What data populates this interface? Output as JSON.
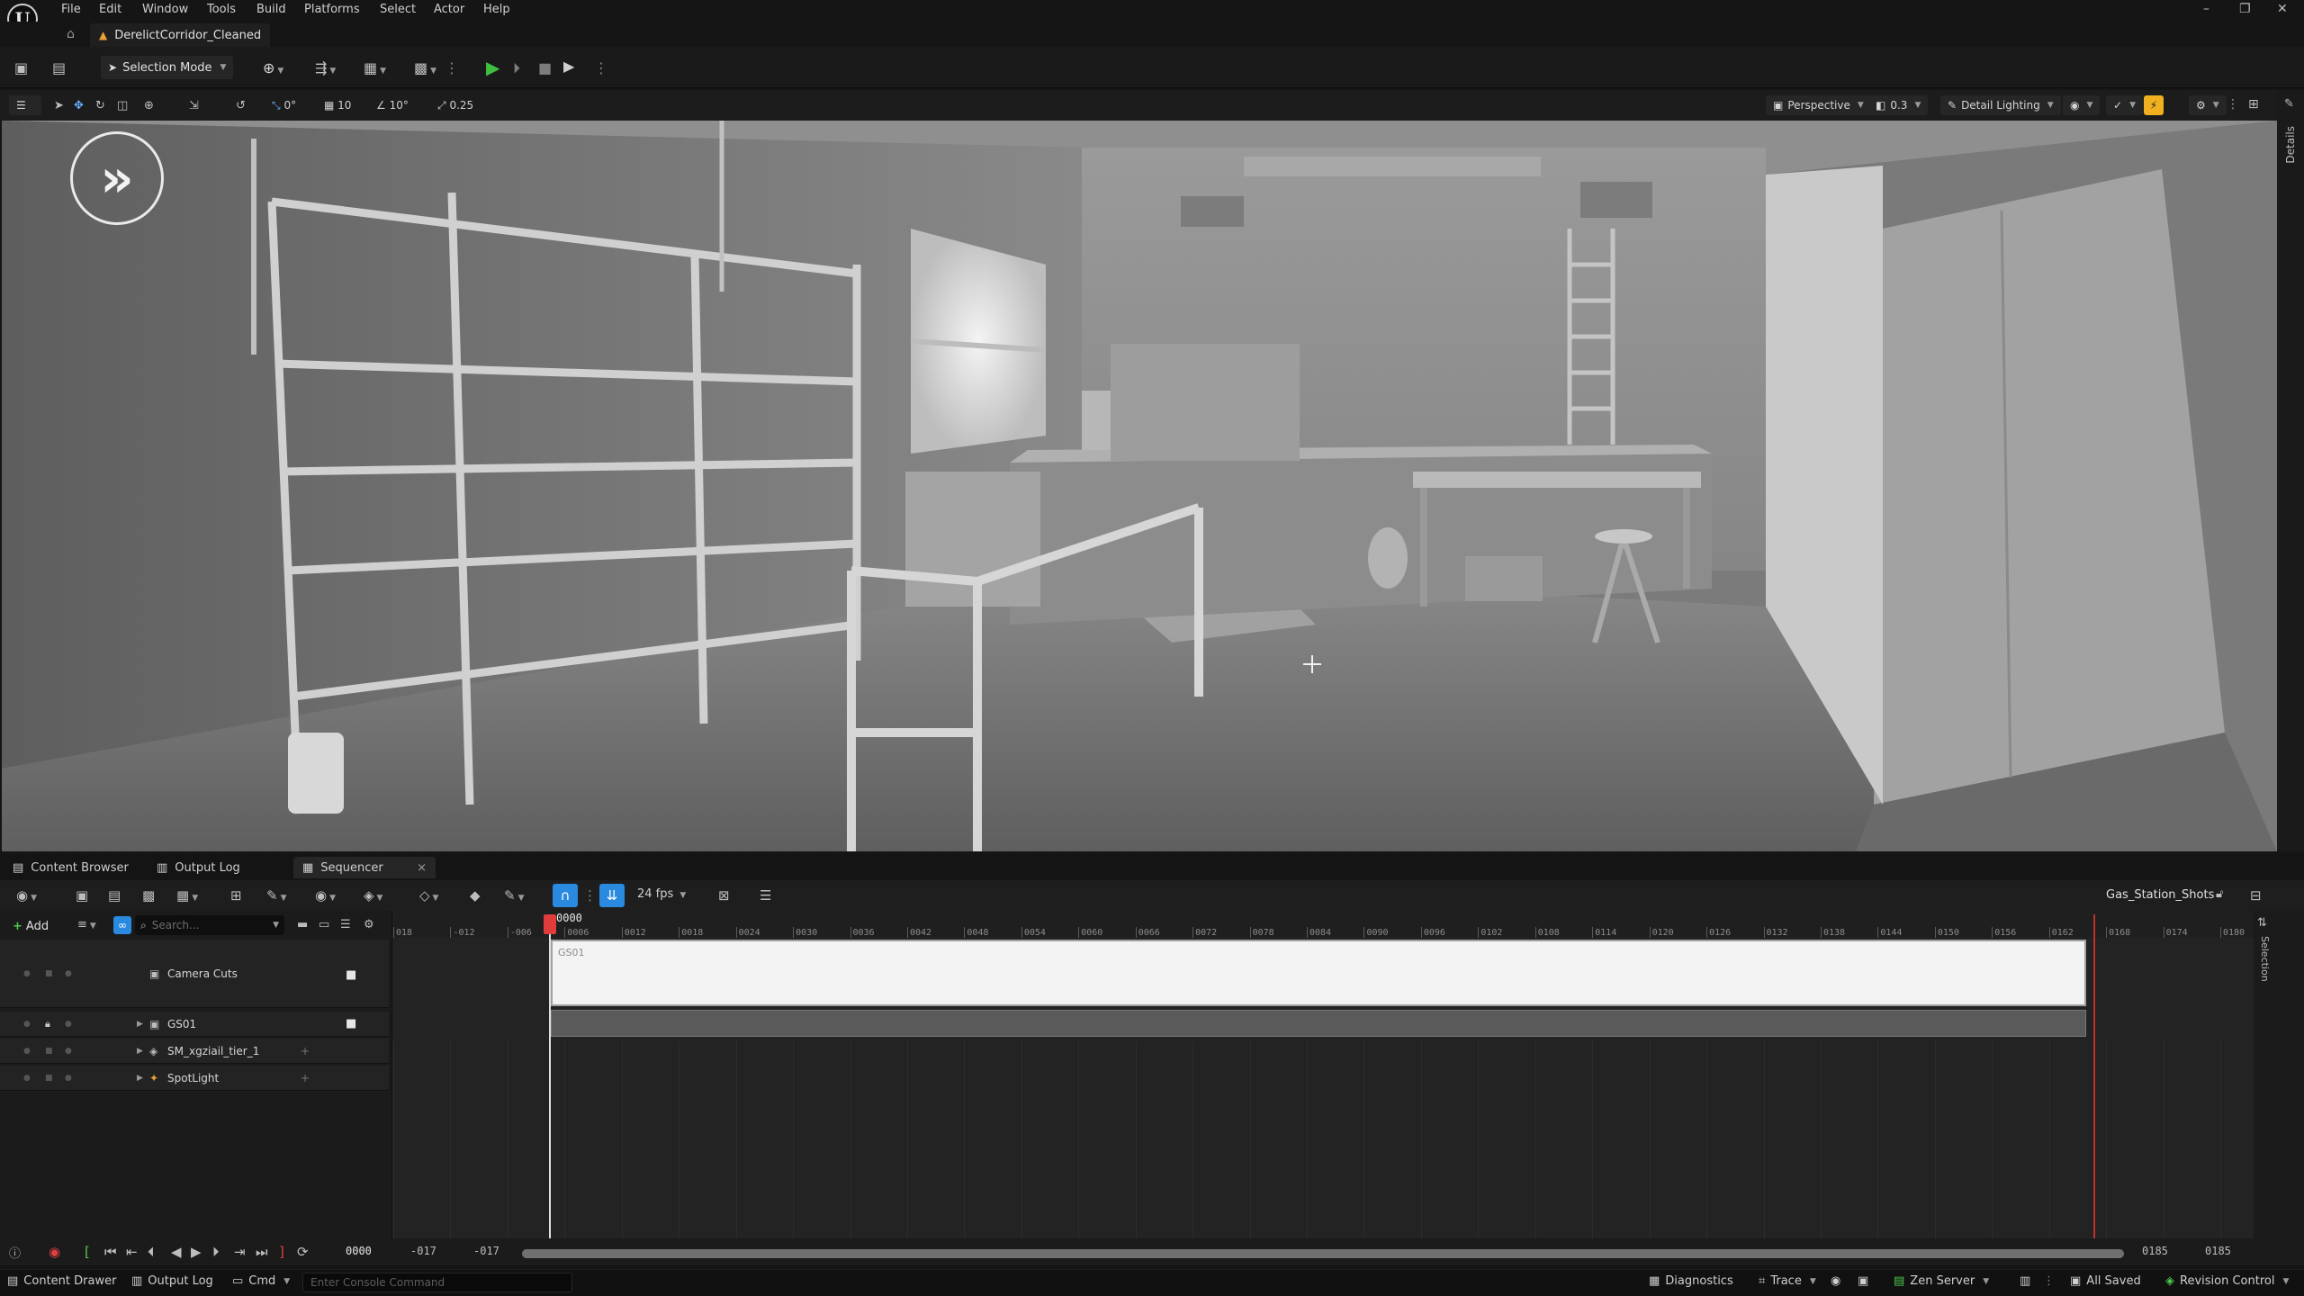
{
  "app": {
    "logo_text": "U",
    "level_name": "DerelictCorridor_Cleaned"
  },
  "menu": [
    "File",
    "Edit",
    "Window",
    "Tools",
    "Build",
    "Platforms",
    "Select",
    "Actor",
    "Help"
  ],
  "window_controls": {
    "minimize": "–",
    "restore": "❐",
    "close": "✕"
  },
  "toolbar": {
    "selection_mode": "Selection Mode"
  },
  "viewport_toolbar": {
    "rotation_snap": "0°",
    "grid_snap": "10",
    "angle_snap": "10°",
    "scale_snap": "0.25",
    "view_mode": "Perspective",
    "camera_speed": "0.3",
    "lighting": "Detail Lighting",
    "right_strip_label": "Details"
  },
  "panel_tabs": {
    "content_browser": "Content Browser",
    "output_log": "Output Log",
    "sequencer": "Sequencer",
    "close": "×"
  },
  "sequencer": {
    "fps": "24 fps",
    "sequence_name": "Gas_Station_Shots",
    "add_label": "Add",
    "search_placeholder": "Search...",
    "tracks": [
      {
        "name": "Camera Cuts"
      },
      {
        "name": "GS01"
      },
      {
        "name": "SM_xgziail_tier_1"
      },
      {
        "name": "SpotLight"
      }
    ],
    "section_label": "GS01",
    "playhead_frame": "0000",
    "ruler_ticks": [
      "018",
      "-012",
      "-006",
      "0006",
      "0012",
      "0018",
      "0024",
      "0030",
      "0036",
      "0042",
      "0048",
      "0054",
      "0060",
      "0066",
      "0072",
      "0078",
      "0084",
      "0090",
      "0096",
      "0102",
      "0108",
      "0114",
      "0120",
      "0126",
      "0132",
      "0138",
      "0144",
      "0150",
      "0156",
      "0162",
      "0168",
      "0174",
      "0180"
    ],
    "current_frame": "0000",
    "range_start": "-017",
    "range_start_2": "-017",
    "range_end": "0185",
    "range_end_2": "0185",
    "selection_label": "Selection"
  },
  "statusbar": {
    "content_drawer": "Content Drawer",
    "output_log": "Output Log",
    "cmd": "Cmd",
    "console_placeholder": "Enter Console Command",
    "diagnostics": "Diagnostics",
    "trace": "Trace",
    "zen_server": "Zen Server",
    "all_saved": "All Saved",
    "revision_control": "Revision Control"
  },
  "colors": {
    "accent_blue": "#2a8ae0",
    "play_green": "#3fbf3f",
    "playhead_red": "#e03c3c"
  }
}
